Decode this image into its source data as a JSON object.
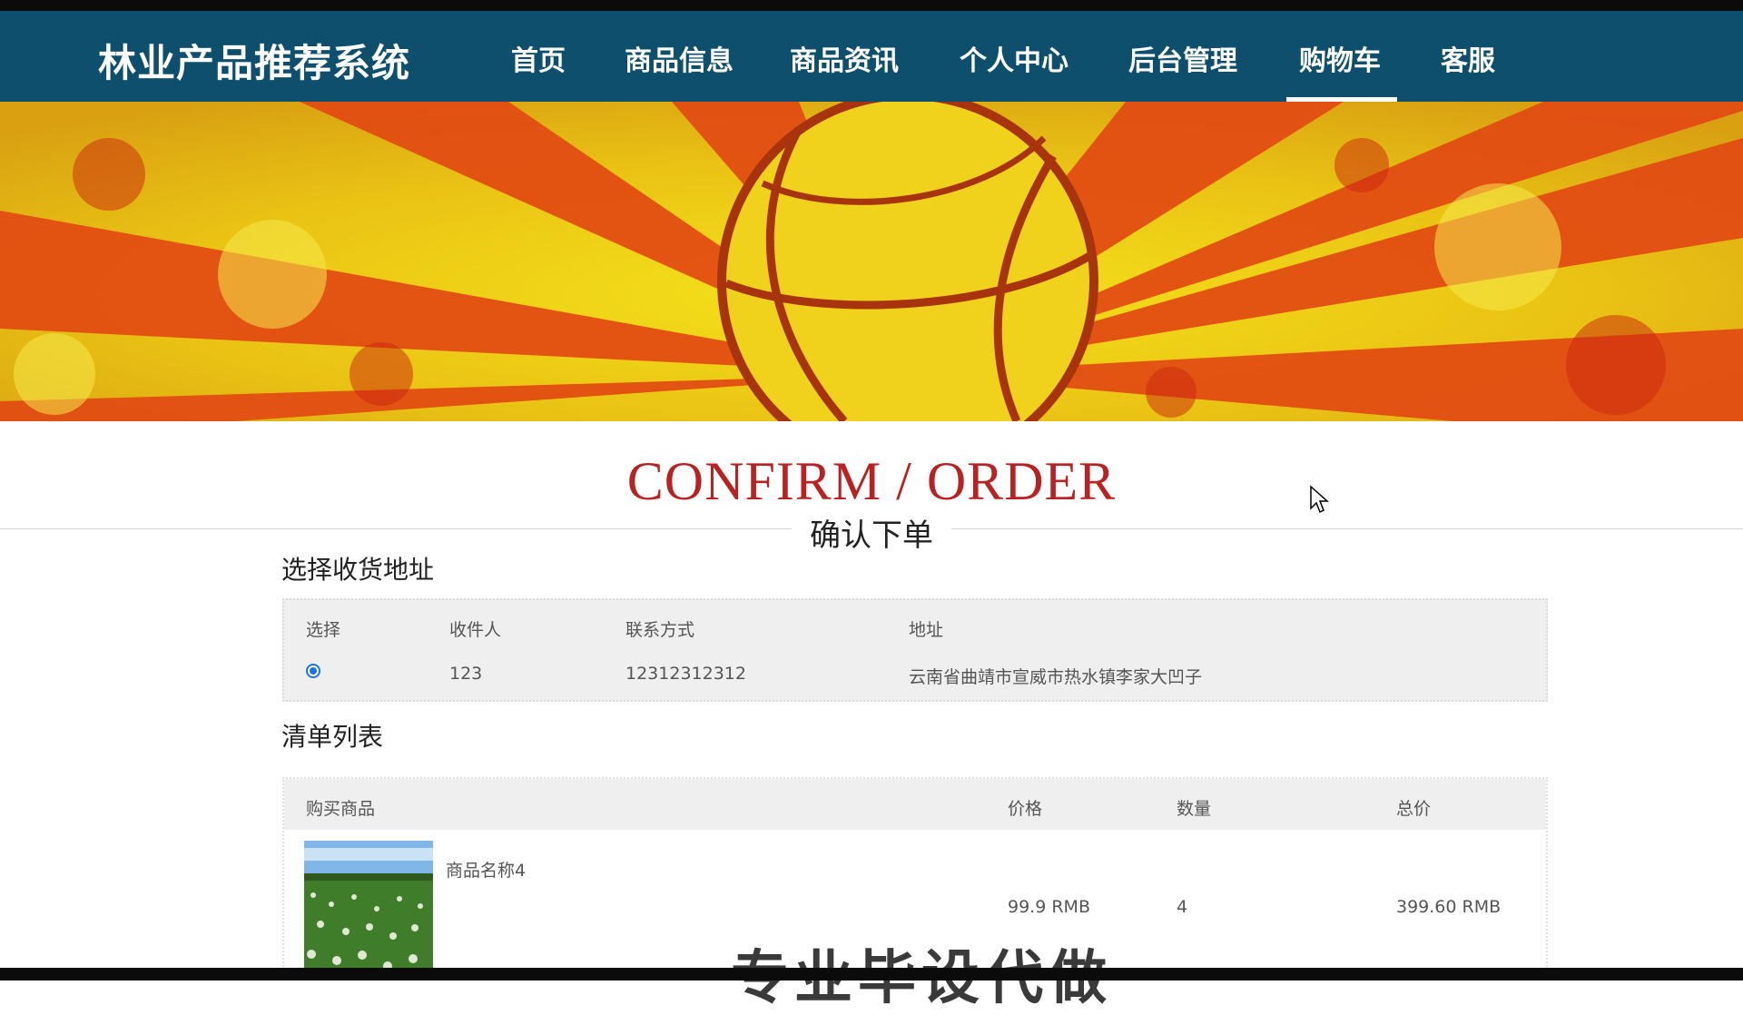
{
  "nav": {
    "brand": "林业产品推荐系统",
    "items": [
      {
        "label": "首页"
      },
      {
        "label": "商品信息"
      },
      {
        "label": "商品资讯"
      },
      {
        "label": "个人中心"
      },
      {
        "label": "后台管理"
      },
      {
        "label": "购物车",
        "active": true
      },
      {
        "label": "客服"
      }
    ]
  },
  "page": {
    "title_en": "CONFIRM / ORDER",
    "title_cn": "确认下单"
  },
  "address": {
    "section_title": "选择收货地址",
    "headers": [
      "选择",
      "收件人",
      "联系方式",
      "地址"
    ],
    "rows": [
      {
        "selected": true,
        "recipient": "123",
        "phone": "12312312312",
        "address": "云南省曲靖市宣威市热水镇李家大凹子"
      }
    ]
  },
  "order_list": {
    "section_title": "清单列表",
    "headers": [
      "购买商品",
      "价格",
      "数量",
      "总价"
    ],
    "items": [
      {
        "name": "商品名称4",
        "price": "99.9 RMB",
        "quantity": "4",
        "total": "399.60 RMB"
      }
    ]
  },
  "overlay_text": "专业毕设代做",
  "colors": {
    "nav_bg": "#0d4f6d",
    "title_accent": "#b82222",
    "radio_accent": "#1a73e8"
  }
}
